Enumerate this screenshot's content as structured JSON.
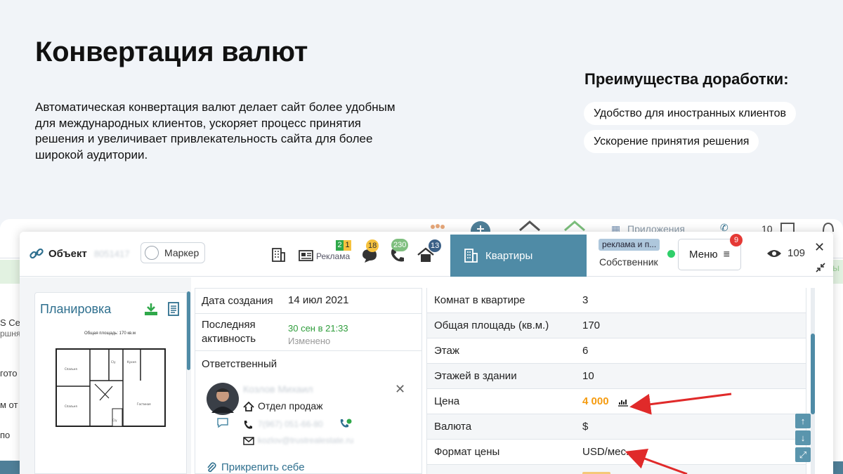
{
  "slide": {
    "title": "Конвертация валют",
    "description": "Автоматическая конвертация валют делает сайт более удобным для международных клиентов, ускоряет процесс принятия решения и увеличивает привлекательность сайта для более широкой аудитории.",
    "advantages_title": "Преимущества доработки:",
    "advantages": [
      "Удобство для иностранных клиентов",
      "Ускорение принятия решения"
    ]
  },
  "background_app": {
    "apps_label": "Приложения",
    "count_label": "10",
    "left_fragments": [
      "S Ce",
      "ршня",
      "гото",
      "м от",
      "по"
    ],
    "right_fragment": "ы"
  },
  "modal": {
    "header": {
      "object_label": "Объект",
      "object_number": "8051417",
      "marker_label": "Маркер",
      "reklama_label": "Реклама",
      "reklama_badges": [
        "2",
        "1"
      ],
      "chat_badge": "18",
      "calls_badge": "230",
      "tasks_badge": "13",
      "active_tab": "Квартиры",
      "tag": "реклама и п...",
      "owner_label": "Собственник",
      "menu_label": "Меню",
      "menu_badge": "9",
      "views_count": "109",
      "colors": {
        "accent": "#4f8ba6",
        "green_badge": "#2fa84a",
        "yellow_badge": "#f6c23e",
        "calls_badge": "#7fbf7f",
        "tasks_badge": "#3a5f86",
        "menu_badge": "#e53935",
        "price": "#f59b0f"
      }
    },
    "plan": {
      "title": "Планировка",
      "area_caption": "Общая площадь: 170 кв.м"
    },
    "info": {
      "created_label": "Дата создания",
      "created_value": "14 июл 2021",
      "activity_label": "Последняя активность",
      "activity_date": "30 сен в 21:33",
      "activity_status": "Изменено",
      "responsible_label": "Ответственный",
      "responsible_name": "Козлов Михаил",
      "department": "Отдел продаж",
      "phone": "7(967) 051-66-80",
      "email": "kozlov@trustrealestate.ru",
      "attach_label": "Прикрепить себе"
    },
    "properties": [
      {
        "label": "Комнат в квартире",
        "value": "3"
      },
      {
        "label": "Общая площадь (кв.м.)",
        "value": "170"
      },
      {
        "label": "Этаж",
        "value": "6"
      },
      {
        "label": "Этажей в здании",
        "value": "10"
      },
      {
        "label": "Цена",
        "value": "4 000"
      },
      {
        "label": "Валюта",
        "value": "$"
      },
      {
        "label": "Формат цены",
        "value": "USD/мес."
      }
    ]
  }
}
